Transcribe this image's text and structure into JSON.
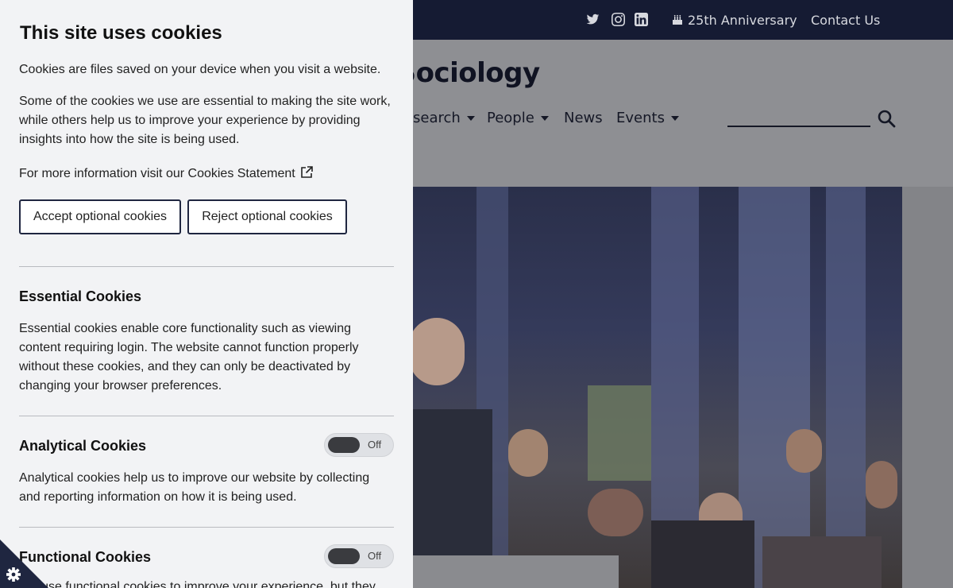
{
  "site": {
    "utility": {
      "anniversary_label": "25th Anniversary",
      "contact_label": "Contact Us"
    },
    "title_fragment": "t of Sociology",
    "nav": [
      {
        "label": "search",
        "dropdown": true
      },
      {
        "label": "People",
        "dropdown": true
      },
      {
        "label": "News",
        "dropdown": false
      },
      {
        "label": "Events",
        "dropdown": true
      }
    ],
    "colors": {
      "topbar": "#151b33",
      "text_dark": "#101322"
    }
  },
  "cookie_panel": {
    "title": "This site uses cookies",
    "intro": "Cookies are files saved on your device when you visit a website.",
    "details": "Some of the cookies we use are essential to making the site work, while others help us to improve your experience by providing insights into how the site is being used.",
    "more_info": "For more information visit our Cookies Statement",
    "accept_label": "Accept optional cookies",
    "reject_label": "Reject optional cookies",
    "sections": {
      "essential": {
        "title": "Essential Cookies",
        "description": "Essential cookies enable core functionality such as viewing content requiring login. The website cannot function properly without these cookies, and they can only be deactivated by changing your browser preferences."
      },
      "analytical": {
        "title": "Analytical Cookies",
        "toggle_label": "Off",
        "description": "Analytical cookies help us to improve our website by collecting and reporting information on how it is being used."
      },
      "functional": {
        "title": "Functional Cookies",
        "toggle_label": "Off",
        "description": "We use functional cookies to improve your experience, but they"
      }
    }
  },
  "icons": [
    "twitter-icon",
    "instagram-icon",
    "linkedin-icon",
    "cake-icon",
    "search-icon",
    "external-link-icon",
    "gear-icon"
  ]
}
